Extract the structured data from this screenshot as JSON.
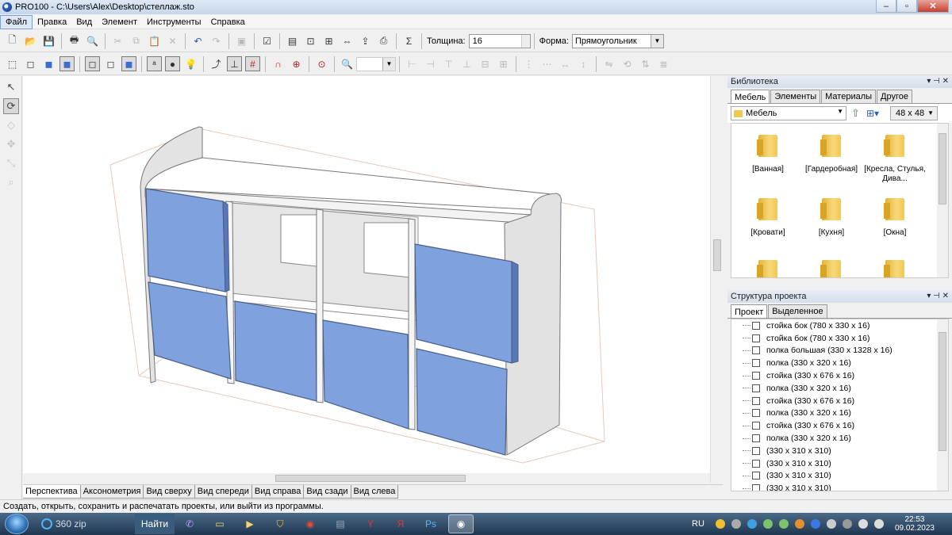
{
  "window": {
    "title": "PRO100 - C:\\Users\\Alex\\Desktop\\стеллаж.sto"
  },
  "menu": [
    "Файл",
    "Правка",
    "Вид",
    "Элемент",
    "Инструменты",
    "Справка"
  ],
  "toolbar": {
    "thickness_label": "Толщина:",
    "thickness_value": "16",
    "shape_label": "Форма:",
    "shape_value": "Прямоугольник"
  },
  "view_tabs": [
    "Перспектива",
    "Аксонометрия",
    "Вид сверху",
    "Вид спереди",
    "Вид справа",
    "Вид сзади",
    "Вид слева"
  ],
  "library": {
    "title": "Библиотека",
    "tabs": [
      "Мебель",
      "Элементы",
      "Материалы",
      "Другое"
    ],
    "folder": "Мебель",
    "icon_size": "48 x 48",
    "items": [
      "[Ванная]",
      "[Гардеробная]",
      "[Кресла, Стулья, Дива...",
      "[Кровати]",
      "[Кухня]",
      "[Окна]"
    ]
  },
  "structure": {
    "title": "Структура проекта",
    "tabs": [
      "Проект",
      "Выделенное"
    ],
    "items": [
      "стойка бок  (780 x 330 x 16)",
      "стойка бок  (780 x 330 x 16)",
      "полка большая  (330 x 1328 x 16)",
      "полка  (330 x 320 x 16)",
      "стойка  (330 x 676 x 16)",
      "полка  (330 x 320 x 16)",
      "стойка  (330 x 676 x 16)",
      "полка  (330 x 320 x 16)",
      "стойка  (330 x 676 x 16)",
      "полка  (330 x 320 x 16)",
      "(330 x 310 x 310)",
      "(330 x 310 x 310)",
      "(330 x 310 x 310)",
      "(330 x 310 x 310)"
    ]
  },
  "status": "Создать, открыть, сохранить и распечатать проекты, или выйти из программы.",
  "taskbar": {
    "search": "360 zip",
    "search_button": "Найти",
    "lang": "RU",
    "time": "22:53",
    "date": "09.02.2023"
  },
  "colors": {
    "door": "#7fa2de",
    "panel": "#eeeeee"
  }
}
